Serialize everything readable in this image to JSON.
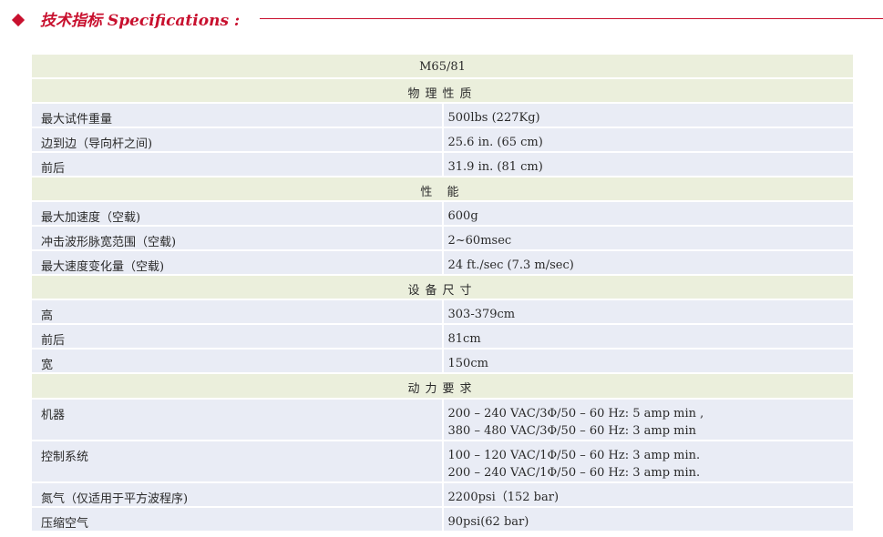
{
  "header": {
    "title": "技术指标 Specifications :"
  },
  "model": "M65/81",
  "sections": [
    {
      "title": "物理性质",
      "rows": [
        {
          "label": "最大试件重量",
          "values": [
            "500lbs (227Kg)"
          ]
        },
        {
          "label": "边到边（导向杆之间)",
          "values": [
            " 25.6 in. (65 cm)"
          ]
        },
        {
          "label": "前后",
          "values": [
            " 31.9 in. (81 cm)"
          ]
        }
      ]
    },
    {
      "title": "性 能",
      "rows": [
        {
          "label": "最大加速度（空载)",
          "values": [
            "600g"
          ]
        },
        {
          "label": "冲击波形脉宽范围（空载)",
          "values": [
            "2~60msec"
          ]
        },
        {
          "label": "最大速度变化量（空载)",
          "values": [
            "24 ft./sec (7.3 m/sec)"
          ]
        }
      ]
    },
    {
      "title": "设备尺寸",
      "rows": [
        {
          "label": "高",
          "values": [
            "303-379cm"
          ]
        },
        {
          "label": "前后",
          "values": [
            "81cm"
          ]
        },
        {
          "label": "宽",
          "values": [
            "150cm"
          ]
        }
      ]
    },
    {
      "title": "动力要求",
      "rows": [
        {
          "label": "机器",
          "values": [
            "200 – 240 VAC/3Φ/50 – 60 Hz: 5 amp min ,",
            "380 – 480 VAC/3Φ/50 – 60 Hz: 3 amp min"
          ]
        },
        {
          "label": "控制系统",
          "values": [
            "100 – 120 VAC/1Φ/50 – 60 Hz: 3 amp min.",
            "200 – 240 VAC/1Φ/50 – 60 Hz: 3 amp min."
          ]
        },
        {
          "label": "氮气（仅适用于平方波程序)",
          "values": [
            "2200psi（152 bar)"
          ]
        },
        {
          "label": "压缩空气",
          "values": [
            "90psi(62 bar)"
          ]
        }
      ]
    }
  ],
  "colors": {
    "accent": "#c8102e",
    "section_bg": "#ebefdc",
    "row_bg": "#e9ecf5"
  }
}
